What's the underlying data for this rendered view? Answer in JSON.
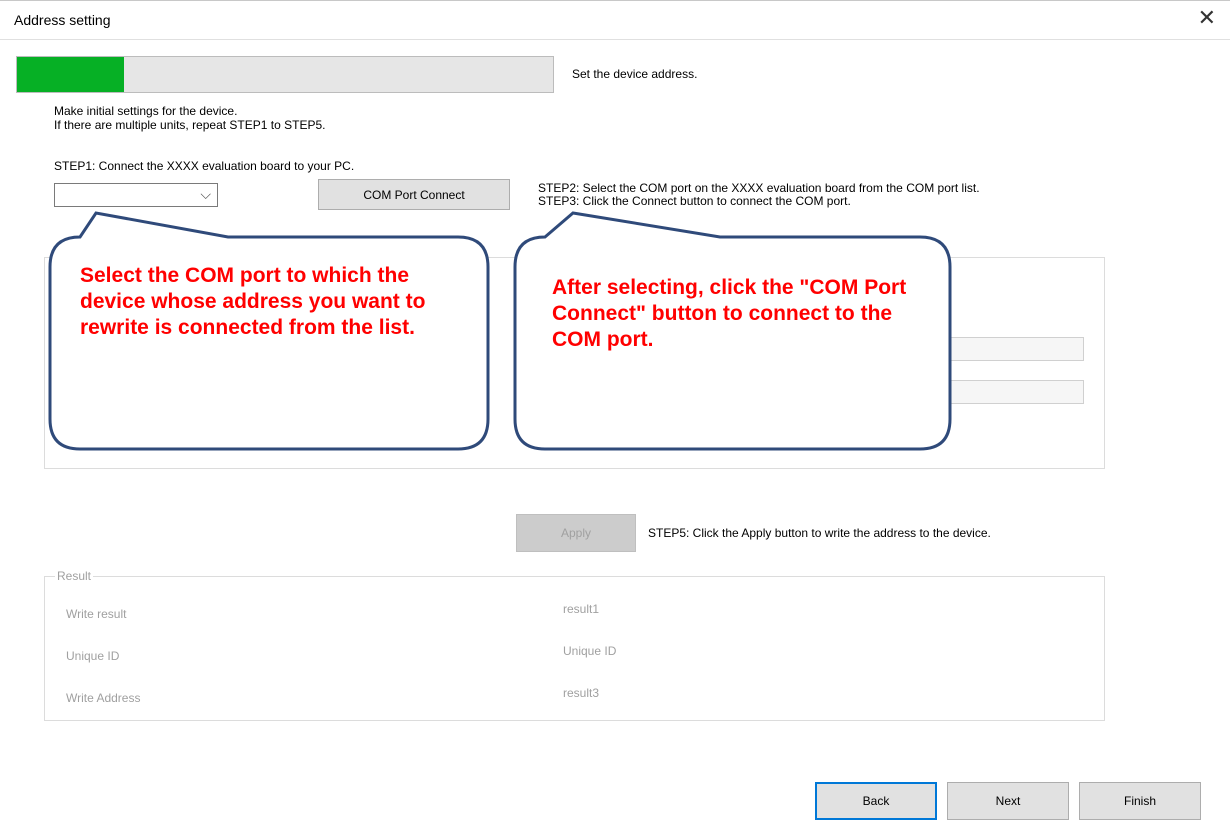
{
  "window": {
    "title": "Address setting",
    "close_glyph": "✕"
  },
  "progress": {
    "fraction": 0.2,
    "fill_color": "#06b025"
  },
  "step_title": "Set the device address.",
  "intro": {
    "line1": "Make initial settings for the device.",
    "line2": "If there are multiple units, repeat STEP1 to STEP5."
  },
  "step1": "STEP1: Connect the XXXX evaluation board to your PC.",
  "com_port": {
    "selected": "",
    "chevron_glyph": "⌵"
  },
  "connect_button": "COM Port Connect",
  "step2": "STEP2: Select the COM port on the XXXX evaluation board from the COM port list.",
  "step3": "STEP3: Click the Connect button to connect the COM port.",
  "callouts": {
    "left": "Select the COM port to which the device whose address you want to rewrite is connected from the list.",
    "right": "After selecting, click the \"COM Port Connect\" button to connect to the COM port.",
    "text_color": "#ff0000",
    "border_color": "#2f4a7a"
  },
  "apply_button": "Apply",
  "step5": "STEP5: Click the Apply button to write the address to the device.",
  "result": {
    "legend": "Result",
    "rows": [
      {
        "label": "Write result",
        "value": "result1"
      },
      {
        "label": "Unique ID",
        "value": "Unique ID"
      },
      {
        "label": "Write Address",
        "value": "result3"
      }
    ]
  },
  "footer": {
    "back": "Back",
    "next": "Next",
    "finish": "Finish"
  }
}
